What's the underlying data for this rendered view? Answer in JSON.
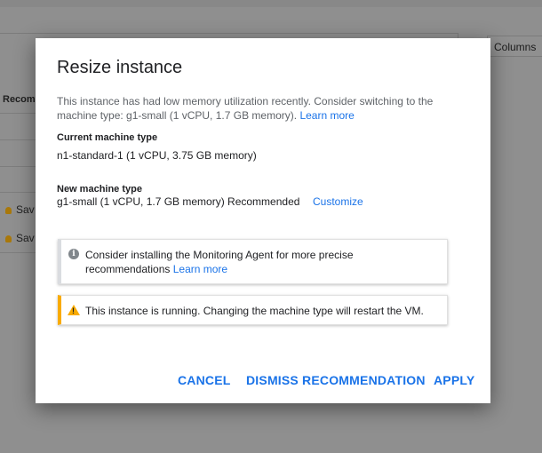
{
  "background": {
    "columns_label": "Columns",
    "header_label": "Recomm",
    "rows": [
      {
        "label": "Sav"
      },
      {
        "label": "Sav"
      }
    ]
  },
  "dialog": {
    "title": "Resize instance",
    "intro_text": "This instance has had low memory utilization recently. Consider switching to the machine type: g1-small (1 vCPU, 1.7 GB memory).",
    "intro_link": "Learn more",
    "current_label": "Current machine type",
    "current_value": "n1-standard-1 (1 vCPU, 3.75 GB memory)",
    "new_label": "New machine type",
    "new_value": "g1-small (1 vCPU, 1.7 GB memory) Recommended",
    "customize_label": "Customize",
    "info_note": {
      "text": "Consider installing the Monitoring Agent for more precise recommendations",
      "link": "Learn more",
      "icon": "info-icon"
    },
    "warning_note": {
      "text": "This instance is running. Changing the machine type will restart the VM.",
      "icon": "warning-icon"
    },
    "buttons": {
      "cancel": "CANCEL",
      "dismiss": "DISMISS RECOMMENDATION",
      "apply": "APPLY"
    }
  },
  "colors": {
    "link": "#1a73e8",
    "warning": "#f9ab00",
    "overlay": "#8f8f8f"
  }
}
